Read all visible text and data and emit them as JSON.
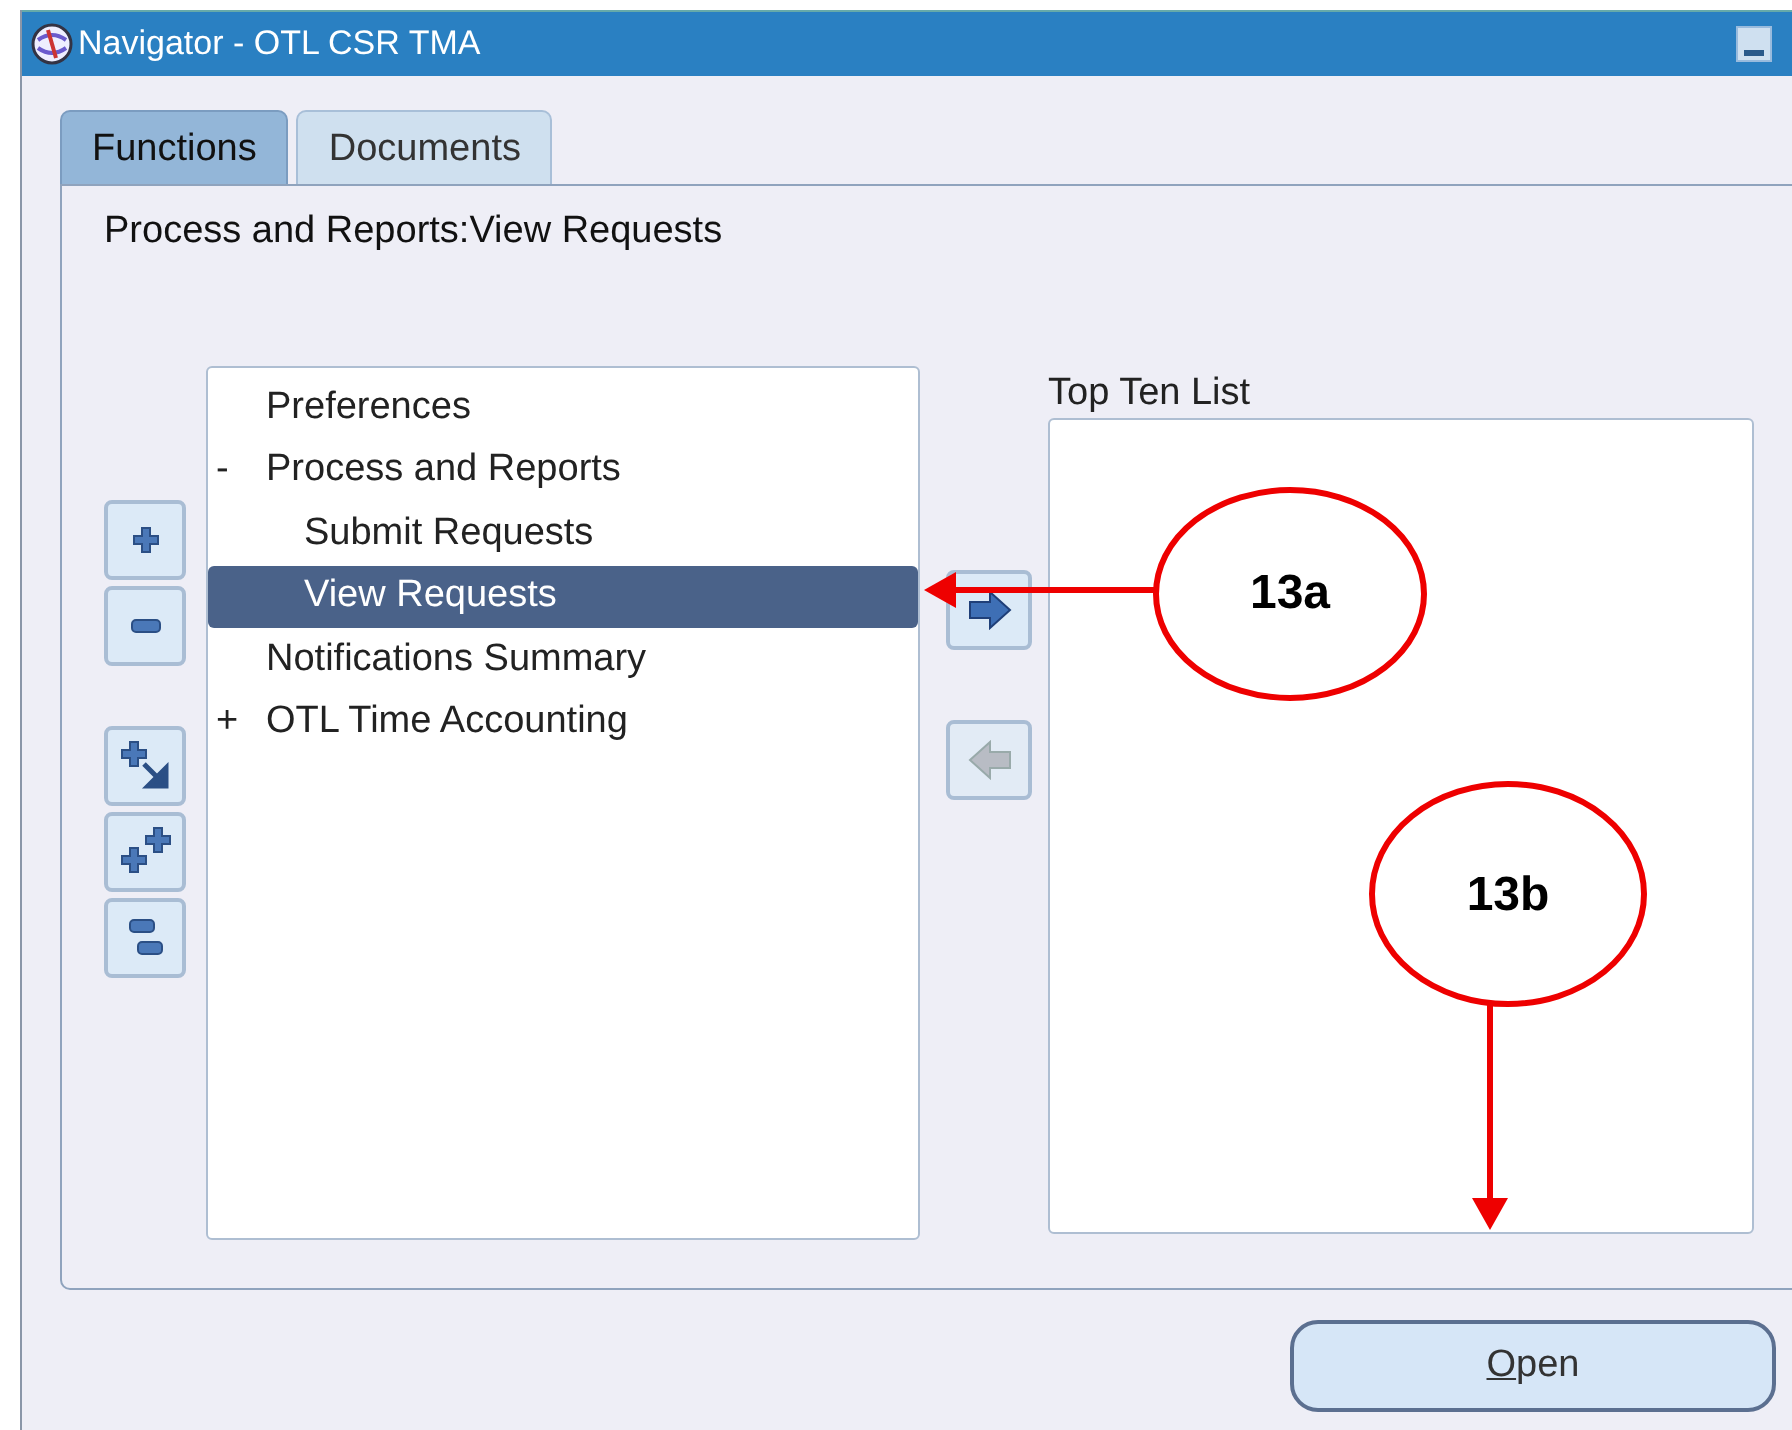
{
  "window": {
    "title": "Navigator - OTL CSR TMA"
  },
  "tabs": [
    {
      "label": "Functions",
      "selected": true
    },
    {
      "label": "Documents",
      "selected": false
    }
  ],
  "path": "Process and Reports:View Requests",
  "tree": [
    {
      "label": "Preferences",
      "selected": false
    },
    {
      "label": "Process and Reports",
      "expander": "-",
      "selected": false,
      "children": [
        {
          "label": "Submit Requests",
          "selected": false
        },
        {
          "label": "View Requests",
          "selected": true
        }
      ]
    },
    {
      "label": "Notifications Summary",
      "selected": false
    },
    {
      "label": "OTL Time Accounting",
      "expander": "+",
      "selected": false
    }
  ],
  "transfer_buttons": [
    {
      "kind": "add",
      "disabled": false
    },
    {
      "kind": "remove",
      "disabled": true
    }
  ],
  "top_ten_list": {
    "label": "Top Ten List"
  },
  "open_button": {
    "label": "Open"
  },
  "annotations": [
    {
      "label": "13a"
    },
    {
      "label": "13b"
    }
  ]
}
